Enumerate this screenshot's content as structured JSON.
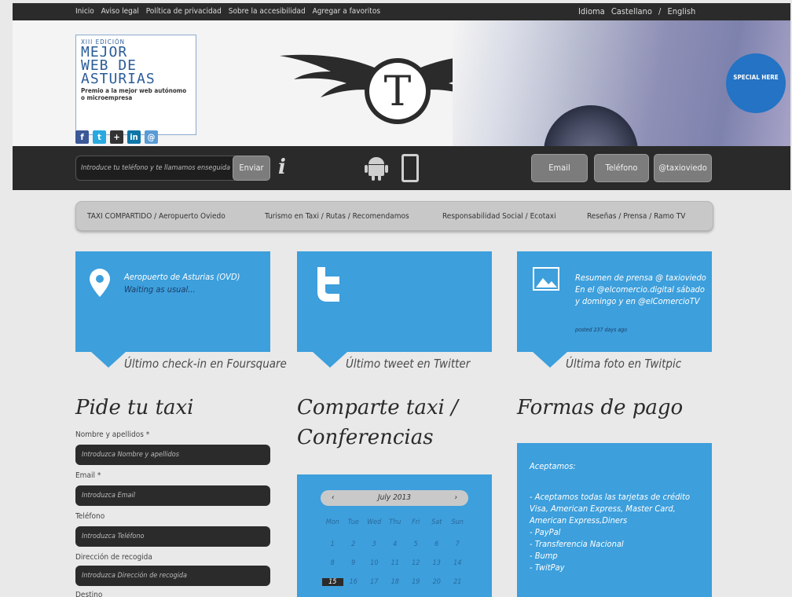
{
  "topbar": {
    "links": [
      "Inicio",
      "Aviso legal",
      "Política de privacidad",
      "Sobre la accesibilidad",
      "Agregar a favoritos"
    ],
    "lang_label": "Idioma",
    "lang_es": "Castellano",
    "lang_sep": "/",
    "lang_en": "English"
  },
  "award": {
    "edition": "XIII EDICIÓN",
    "line1": "MEJOR",
    "line2": "WEB DE",
    "line3": "ASTURIAS",
    "desc": "Premio a la mejor web autónomo o microempresa"
  },
  "logo": {
    "letter": "T"
  },
  "car": {
    "sticker": "SPECIAL HERE"
  },
  "social": [
    "f",
    "t",
    "+",
    "in",
    "@"
  ],
  "toolbar": {
    "phone_placeholder": "Introduce tu teléfono y te llamamos enseguida",
    "send_label": "Enviar",
    "info_label": "i",
    "email_label": "Email",
    "phone_label": "Teléfono",
    "twitter_label": "@taxioviedo"
  },
  "nav": {
    "items": [
      "TAXI COMPARTIDO / Aeropuerto Oviedo",
      "Turismo en Taxi / Rutas / Recomendamos",
      "Responsabilidad Social / Ecotaxi",
      "Reseñas / Prensa / Ramo TV"
    ]
  },
  "cards": [
    {
      "text1": "Aeropuerto de Asturias (OVD)",
      "text2": "Waiting as usual...",
      "caption": "Último check-in en Foursquare"
    },
    {
      "caption": "Último tweet en Twitter"
    },
    {
      "text": "Resumen de prensa @ taxioviedo En el @elcomercio.digital sábado y domingo y en @elComercioTV",
      "time": "posted 237 days ago",
      "caption": "Última foto en Twitpic"
    }
  ],
  "order": {
    "title": "Pide tu taxi",
    "fields": [
      {
        "label": "Nombre y apellidos *",
        "placeholder": "Introduzca Nombre y apellidos"
      },
      {
        "label": "Email *",
        "placeholder": "Introduzca Email"
      },
      {
        "label": "Teléfono",
        "placeholder": "Introduzca Teléfono"
      },
      {
        "label": "Dirección de recogida",
        "placeholder": "Introduzca Dirección de recogida"
      },
      {
        "label": "Destino"
      }
    ]
  },
  "share": {
    "title1": "Comparte taxi /",
    "title2": "Conferencias",
    "calendar": {
      "month": "July 2013",
      "prev": "‹",
      "next": "›",
      "days": [
        "Mon",
        "Tue",
        "Wed",
        "Thu",
        "Fri",
        "Sat",
        "Sun"
      ],
      "week1": [
        "1",
        "2",
        "3",
        "4",
        "5",
        "6",
        "7"
      ],
      "week2": [
        "8",
        "9",
        "10",
        "11",
        "12",
        "13",
        "14"
      ],
      "week3": [
        "15",
        "16",
        "17",
        "18",
        "19",
        "20",
        "21"
      ]
    }
  },
  "payment": {
    "title": "Formas de pago",
    "heading": "Aceptamos:",
    "lines": [
      "- Aceptamos todas las tarjetas de crédito Visa, American Express, Master Card, American Express,Diners",
      "- PayPal",
      "- Transferencia Nacional",
      "- Bump",
      "- TwitPay"
    ]
  }
}
